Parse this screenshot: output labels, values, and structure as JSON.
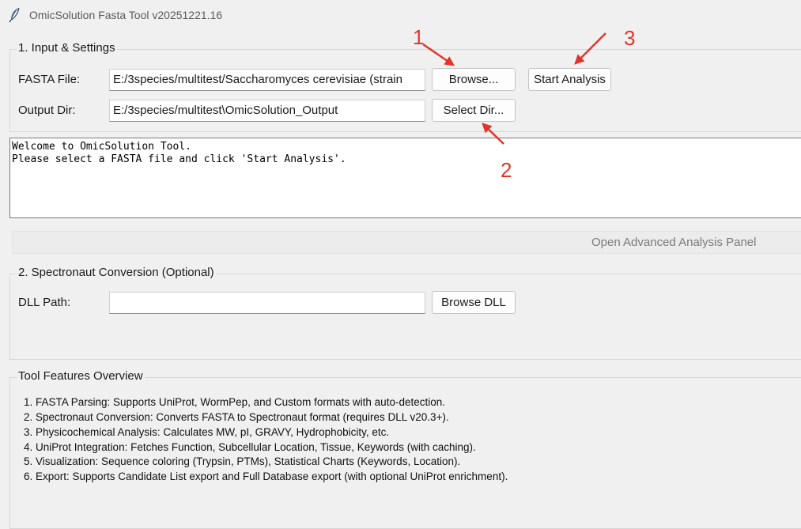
{
  "window": {
    "title": "OmicSolution Fasta Tool v20251221.16",
    "icon": "feather-icon"
  },
  "input_settings": {
    "legend": "1. Input & Settings",
    "fasta_label": "FASTA File:",
    "fasta_value": "E:/3species/multitest/Saccharomyces cerevisiae (strain",
    "browse_button": "Browse...",
    "start_button": "Start Analysis",
    "output_label": "Output Dir:",
    "output_value": "E:/3species/multitest\\OmicSolution_Output",
    "select_dir_button": "Select Dir..."
  },
  "log": {
    "lines": [
      "Welcome to OmicSolution Tool.",
      "Please select a FASTA file and click 'Start Analysis'."
    ]
  },
  "advanced": {
    "button": "Open Advanced Analysis Panel"
  },
  "spectronaut": {
    "legend": "2. Spectronaut Conversion (Optional)",
    "dll_label": "DLL Path:",
    "dll_value": "",
    "browse_dll_button": "Browse DLL"
  },
  "features": {
    "legend": "Tool Features Overview",
    "items": [
      "1. FASTA Parsing: Supports UniProt, WormPep, and Custom formats with auto-detection.",
      "2. Spectronaut Conversion: Converts FASTA to Spectronaut format (requires DLL v20.3+).",
      "3. Physicochemical Analysis: Calculates MW, pI, GRAVY, Hydrophobicity, etc.",
      "4. UniProt Integration: Fetches Function, Subcellular Location, Tissue, Keywords (with caching).",
      "5. Visualization: Sequence coloring (Trypsin, PTMs), Statistical Charts (Keywords, Location).",
      "6. Export: Supports Candidate List export and Full Database export (with optional UniProt enrichment)."
    ]
  },
  "annotations": {
    "one": "1",
    "two": "2",
    "three": "3",
    "color": "#e2352a"
  }
}
